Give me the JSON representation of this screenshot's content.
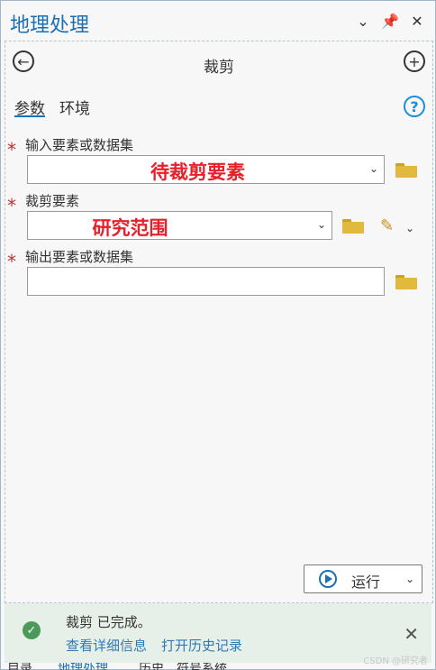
{
  "window": {
    "title": "地理处理",
    "controls": {
      "options_icon": "chevron-down-icon",
      "pin_icon": "pin-icon",
      "close_icon": "close-icon"
    }
  },
  "tool": {
    "title": "裁剪",
    "back_icon": "back-arrow-icon",
    "add_icon": "add-icon"
  },
  "tabs": [
    {
      "label": "参数",
      "active": true
    },
    {
      "label": "环境",
      "active": false
    }
  ],
  "help": "?",
  "params": [
    {
      "label": "输入要素或数据集",
      "value": "待裁剪要素",
      "required": true
    },
    {
      "label": "裁剪要素",
      "value": "研究范围",
      "required": true
    },
    {
      "label": "输出要素或数据集",
      "value": "",
      "required": true
    }
  ],
  "run": {
    "label": "运行"
  },
  "status": {
    "message": "裁剪 已完成。",
    "link_details": "查看详细信息",
    "link_history": "打开历史记录"
  },
  "bottom_tabs": [
    "目录",
    "地理处理",
    "历史",
    "符号系统"
  ],
  "watermark": "CSDN @研究者",
  "colors": {
    "accent": "#1a6fb5",
    "required": "#c43030",
    "value_red": "#e8202a",
    "success": "#4c9a5b"
  }
}
